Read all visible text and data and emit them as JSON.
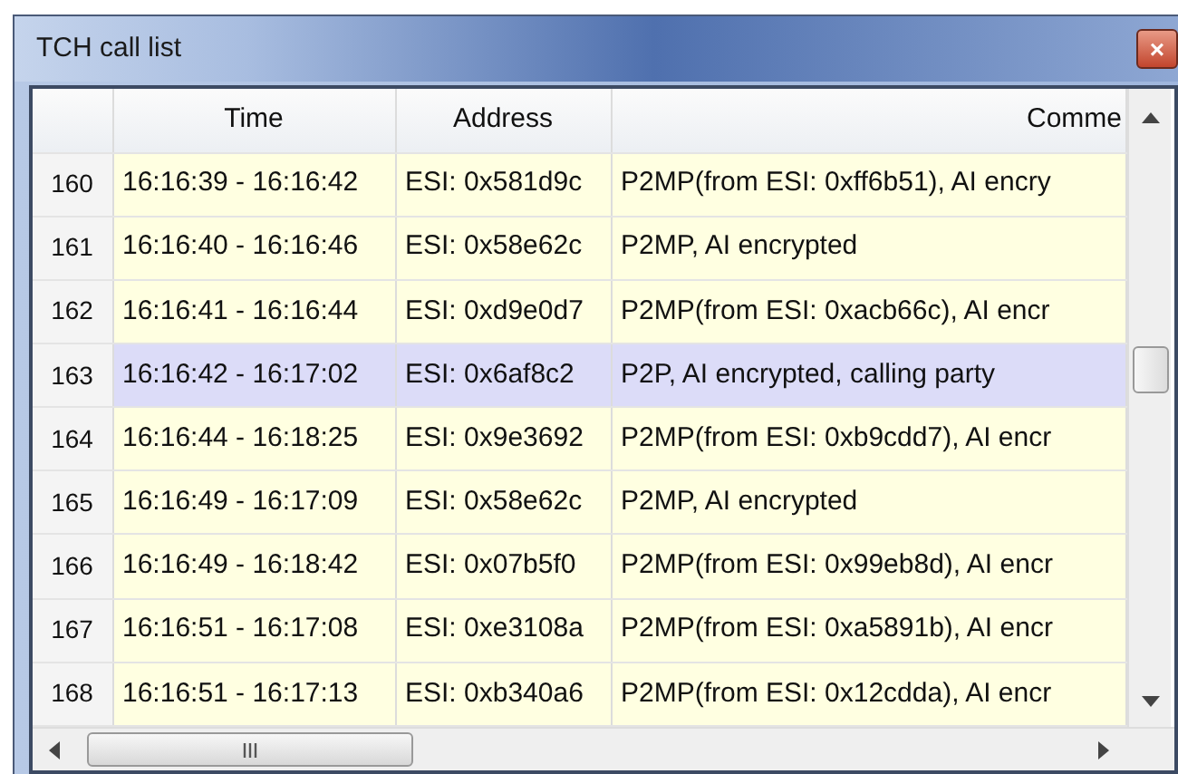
{
  "window": {
    "title": "TCH call list",
    "close": "×"
  },
  "table": {
    "columns": [
      "",
      "Time",
      "Address",
      "Comme"
    ],
    "rows": [
      {
        "number": "160",
        "time": "16:16:39 - 16:16:42",
        "address": "ESI: 0x581d9c",
        "comment": "P2MP(from ESI: 0xff6b51), AI encry",
        "selected": false
      },
      {
        "number": "161",
        "time": "16:16:40 - 16:16:46",
        "address": "ESI: 0x58e62c",
        "comment": "P2MP, AI encrypted",
        "selected": false
      },
      {
        "number": "162",
        "time": "16:16:41 - 16:16:44",
        "address": "ESI: 0xd9e0d7",
        "comment": "P2MP(from ESI: 0xacb66c), AI encr",
        "selected": false
      },
      {
        "number": "163",
        "time": "16:16:42 - 16:17:02",
        "address": "ESI: 0x6af8c2",
        "comment": "P2P, AI encrypted, calling party",
        "selected": true
      },
      {
        "number": "164",
        "time": "16:16:44 - 16:18:25",
        "address": "ESI: 0x9e3692",
        "comment": "P2MP(from ESI: 0xb9cdd7), AI encr",
        "selected": false
      },
      {
        "number": "165",
        "time": "16:16:49 - 16:17:09",
        "address": "ESI: 0x58e62c",
        "comment": "P2MP, AI encrypted",
        "selected": false
      },
      {
        "number": "166",
        "time": "16:16:49 - 16:18:42",
        "address": "ESI: 0x07b5f0",
        "comment": "P2MP(from ESI: 0x99eb8d), AI encr",
        "selected": false
      },
      {
        "number": "167",
        "time": "16:16:51 - 16:17:08",
        "address": "ESI: 0xe3108a",
        "comment": "P2MP(from ESI: 0xa5891b), AI encr",
        "selected": false
      },
      {
        "number": "168",
        "time": "16:16:51 - 16:17:13",
        "address": "ESI: 0xb340a6",
        "comment": "P2MP(from ESI: 0x12cdda), AI encr",
        "selected": false
      }
    ]
  }
}
